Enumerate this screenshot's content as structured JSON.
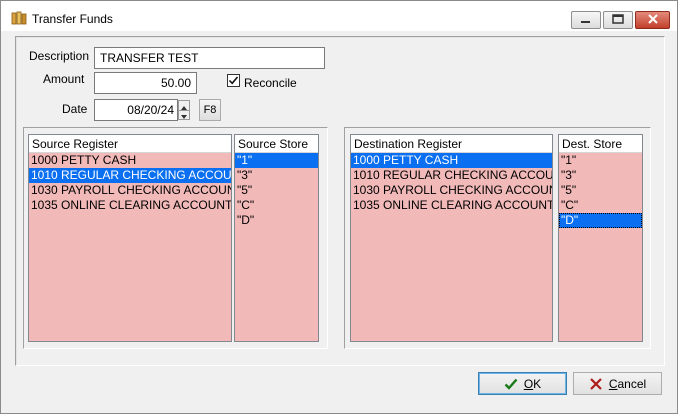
{
  "window": {
    "title": "Transfer Funds"
  },
  "form": {
    "description_label": "Description",
    "description_value": "TRANSFER TEST",
    "amount_label": "Amount",
    "amount_value": "50.00",
    "reconcile_label": "Reconcile",
    "reconcile_checked": true,
    "date_label": "Date",
    "date_value": "08/20/24",
    "f8_label": "F8"
  },
  "source_register": {
    "header": "Source Register",
    "rows": [
      {
        "code": "1000",
        "name": "PETTY CASH",
        "selected": false
      },
      {
        "code": "1010",
        "name": "REGULAR CHECKING ACCOUNT",
        "selected": true
      },
      {
        "code": "1030",
        "name": "PAYROLL CHECKING ACCOUNT",
        "selected": false
      },
      {
        "code": "1035",
        "name": "ONLINE CLEARING ACCOUNT",
        "selected": false
      }
    ]
  },
  "source_store": {
    "header": "Source Store",
    "rows": [
      {
        "value": "\"1\"",
        "selected": true
      },
      {
        "value": "\"3\"",
        "selected": false
      },
      {
        "value": "\"5\"",
        "selected": false
      },
      {
        "value": "\"C\"",
        "selected": false
      },
      {
        "value": "\"D\"",
        "selected": false
      }
    ]
  },
  "destination_register": {
    "header": "Destination Register",
    "rows": [
      {
        "code": "1000",
        "name": "PETTY CASH",
        "selected": true
      },
      {
        "code": "1010",
        "name": "REGULAR CHECKING ACCOUNT",
        "selected": false
      },
      {
        "code": "1030",
        "name": "PAYROLL CHECKING ACCOUNT",
        "selected": false
      },
      {
        "code": "1035",
        "name": "ONLINE CLEARING ACCOUNT",
        "selected": false
      }
    ]
  },
  "dest_store": {
    "header": "Dest. Store",
    "rows": [
      {
        "value": "\"1\"",
        "selected": false
      },
      {
        "value": "\"3\"",
        "selected": false
      },
      {
        "value": "\"5\"",
        "selected": false
      },
      {
        "value": "\"C\"",
        "selected": false
      },
      {
        "value": "\"D\"",
        "selected": true
      }
    ]
  },
  "buttons": {
    "ok_label": "OK",
    "cancel_label": "Cancel"
  },
  "icons": {
    "app": "ledger-icon",
    "minimize": "minimize-icon",
    "maximize": "maximize-icon",
    "close": "close-icon",
    "ok": "checkmark-icon",
    "cancel": "x-icon"
  },
  "colors": {
    "list_background": "#f2b9b9",
    "selection": "#0a6ff0",
    "close_button": "#c2402b"
  }
}
